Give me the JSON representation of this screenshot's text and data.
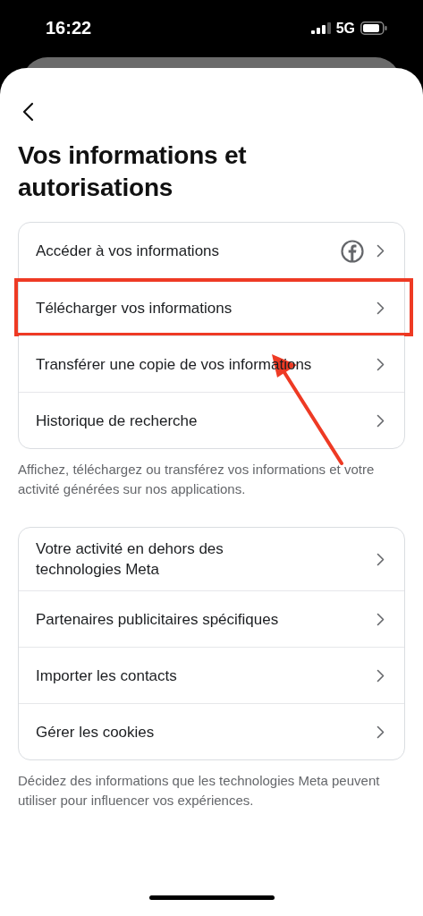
{
  "status_bar": {
    "time": "16:22",
    "network": "5G"
  },
  "title": "Vos informations et autorisations",
  "sections": [
    {
      "items": [
        {
          "label": "Accéder à vos informations",
          "kind": "facebook",
          "highlighted": false
        },
        {
          "label": "Télécharger vos informations",
          "kind": "plain",
          "highlighted": true
        },
        {
          "label": "Transférer une copie de vos informations",
          "kind": "plain",
          "highlighted": false
        },
        {
          "label": "Historique de recherche",
          "kind": "plain",
          "highlighted": false
        }
      ],
      "note": "Affichez, téléchargez ou transférez vos informations et votre activité générées sur nos applications."
    },
    {
      "items": [
        {
          "label": "Votre activité en dehors des technologies Meta",
          "kind": "plain",
          "highlighted": false
        },
        {
          "label": "Partenaires publicitaires spécifiques",
          "kind": "plain",
          "highlighted": false
        },
        {
          "label": "Importer les contacts",
          "kind": "plain",
          "highlighted": false
        },
        {
          "label": "Gérer les cookies",
          "kind": "plain",
          "highlighted": false
        }
      ],
      "note": "Décidez des informations que les technologies Meta peuvent utiliser pour influencer vos expériences."
    }
  ]
}
